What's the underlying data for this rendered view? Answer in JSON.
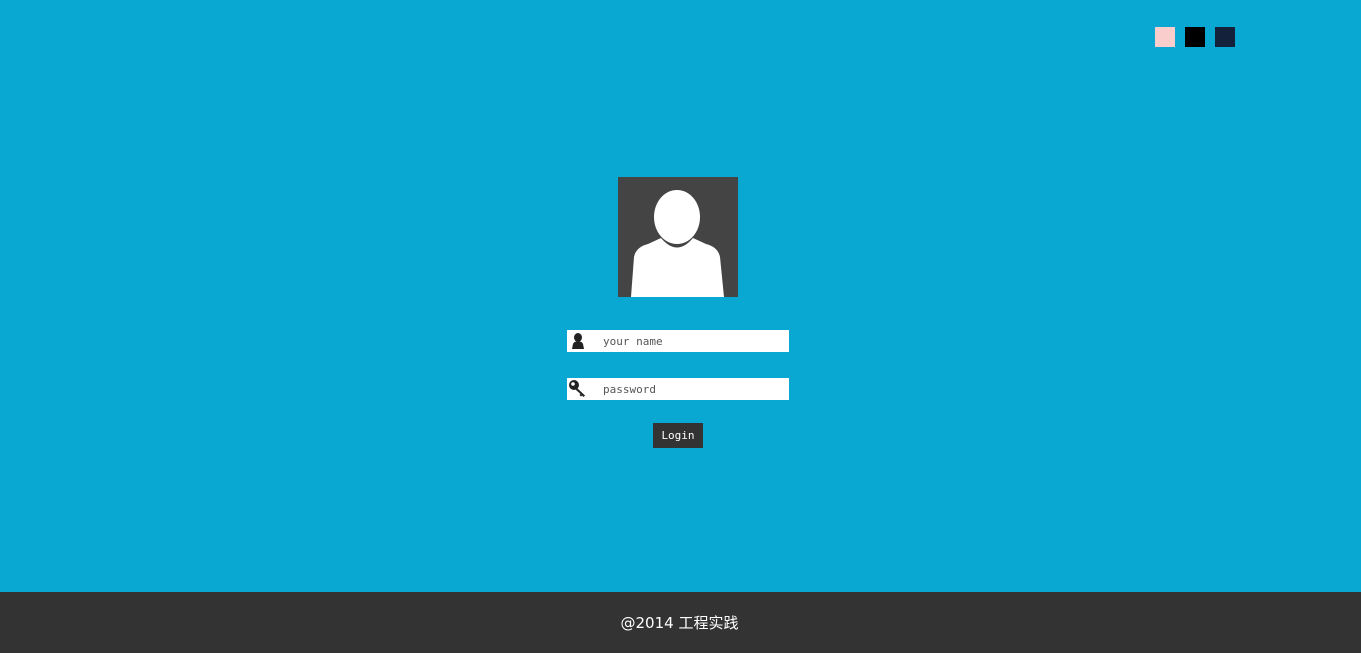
{
  "colors": {
    "background": "#08a8d2",
    "avatar_bg": "#444444",
    "footer_bg": "#333333",
    "button_bg": "#333333"
  },
  "theme_swatches": [
    {
      "name": "pink",
      "color": "#f9cdcb"
    },
    {
      "name": "black",
      "color": "#000000"
    },
    {
      "name": "navy",
      "color": "#13213a"
    }
  ],
  "avatar": {
    "icon": "user-silhouette-icon"
  },
  "login_form": {
    "username": {
      "placeholder": "your name",
      "value": "",
      "icon": "user-icon"
    },
    "password": {
      "placeholder": "password",
      "value": "",
      "icon": "key-icon"
    },
    "submit_label": "Login"
  },
  "footer": {
    "text": "@2014 工程实践"
  }
}
